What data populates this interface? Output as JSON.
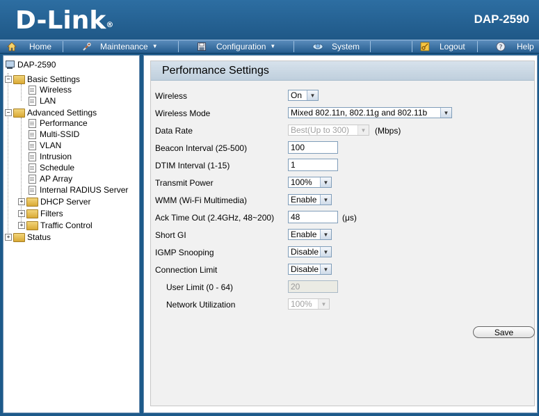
{
  "header": {
    "logo": "D-Link",
    "logo_mark": "®",
    "model": "DAP-2590"
  },
  "menu": [
    {
      "label": "Home",
      "icon": "home-icon"
    },
    {
      "label": "Maintenance",
      "icon": "tools-icon"
    },
    {
      "label": "Configuration",
      "icon": "disk-icon"
    },
    {
      "label": "System",
      "icon": "system-icon"
    },
    {
      "label": "Logout",
      "icon": "logout-icon"
    },
    {
      "label": "Help",
      "icon": "help-icon"
    }
  ],
  "tree": {
    "root": "DAP-2590",
    "basic": "Basic Settings",
    "wireless": "Wireless",
    "lan": "LAN",
    "advanced": "Advanced Settings",
    "performance": "Performance",
    "multi_ssid": "Multi-SSID",
    "vlan": "VLAN",
    "intrusion": "Intrusion",
    "schedule": "Schedule",
    "ap_array": "AP Array",
    "radius": "Internal RADIUS Server",
    "dhcp": "DHCP Server",
    "filters": "Filters",
    "traffic": "Traffic Control",
    "status": "Status"
  },
  "panel": {
    "title": "Performance Settings",
    "fields": {
      "wireless": {
        "label": "Wireless",
        "value": "On"
      },
      "mode": {
        "label": "Wireless Mode",
        "value": "Mixed 802.11n, 802.11g and 802.11b"
      },
      "rate": {
        "label": "Data Rate",
        "value": "Best(Up to 300)",
        "unit": "(Mbps)"
      },
      "beacon": {
        "label": "Beacon Interval (25-500)",
        "value": "100"
      },
      "dtim": {
        "label": "DTIM Interval (1-15)",
        "value": "1"
      },
      "power": {
        "label": "Transmit Power",
        "value": "100%"
      },
      "wmm": {
        "label": "WMM (Wi-Fi Multimedia)",
        "value": "Enable"
      },
      "ack": {
        "label": "Ack Time Out  (2.4GHz, 48~200)",
        "value": "48",
        "unit": "(μs)"
      },
      "short_gi": {
        "label": "Short GI",
        "value": "Enable"
      },
      "igmp": {
        "label": "IGMP Snooping",
        "value": "Disable"
      },
      "conn_limit": {
        "label": "Connection Limit",
        "value": "Disable"
      },
      "user_limit": {
        "label": "User Limit (0 - 64)",
        "value": "20"
      },
      "net_util": {
        "label": "Network Utilization",
        "value": "100%"
      }
    },
    "save": "Save"
  }
}
